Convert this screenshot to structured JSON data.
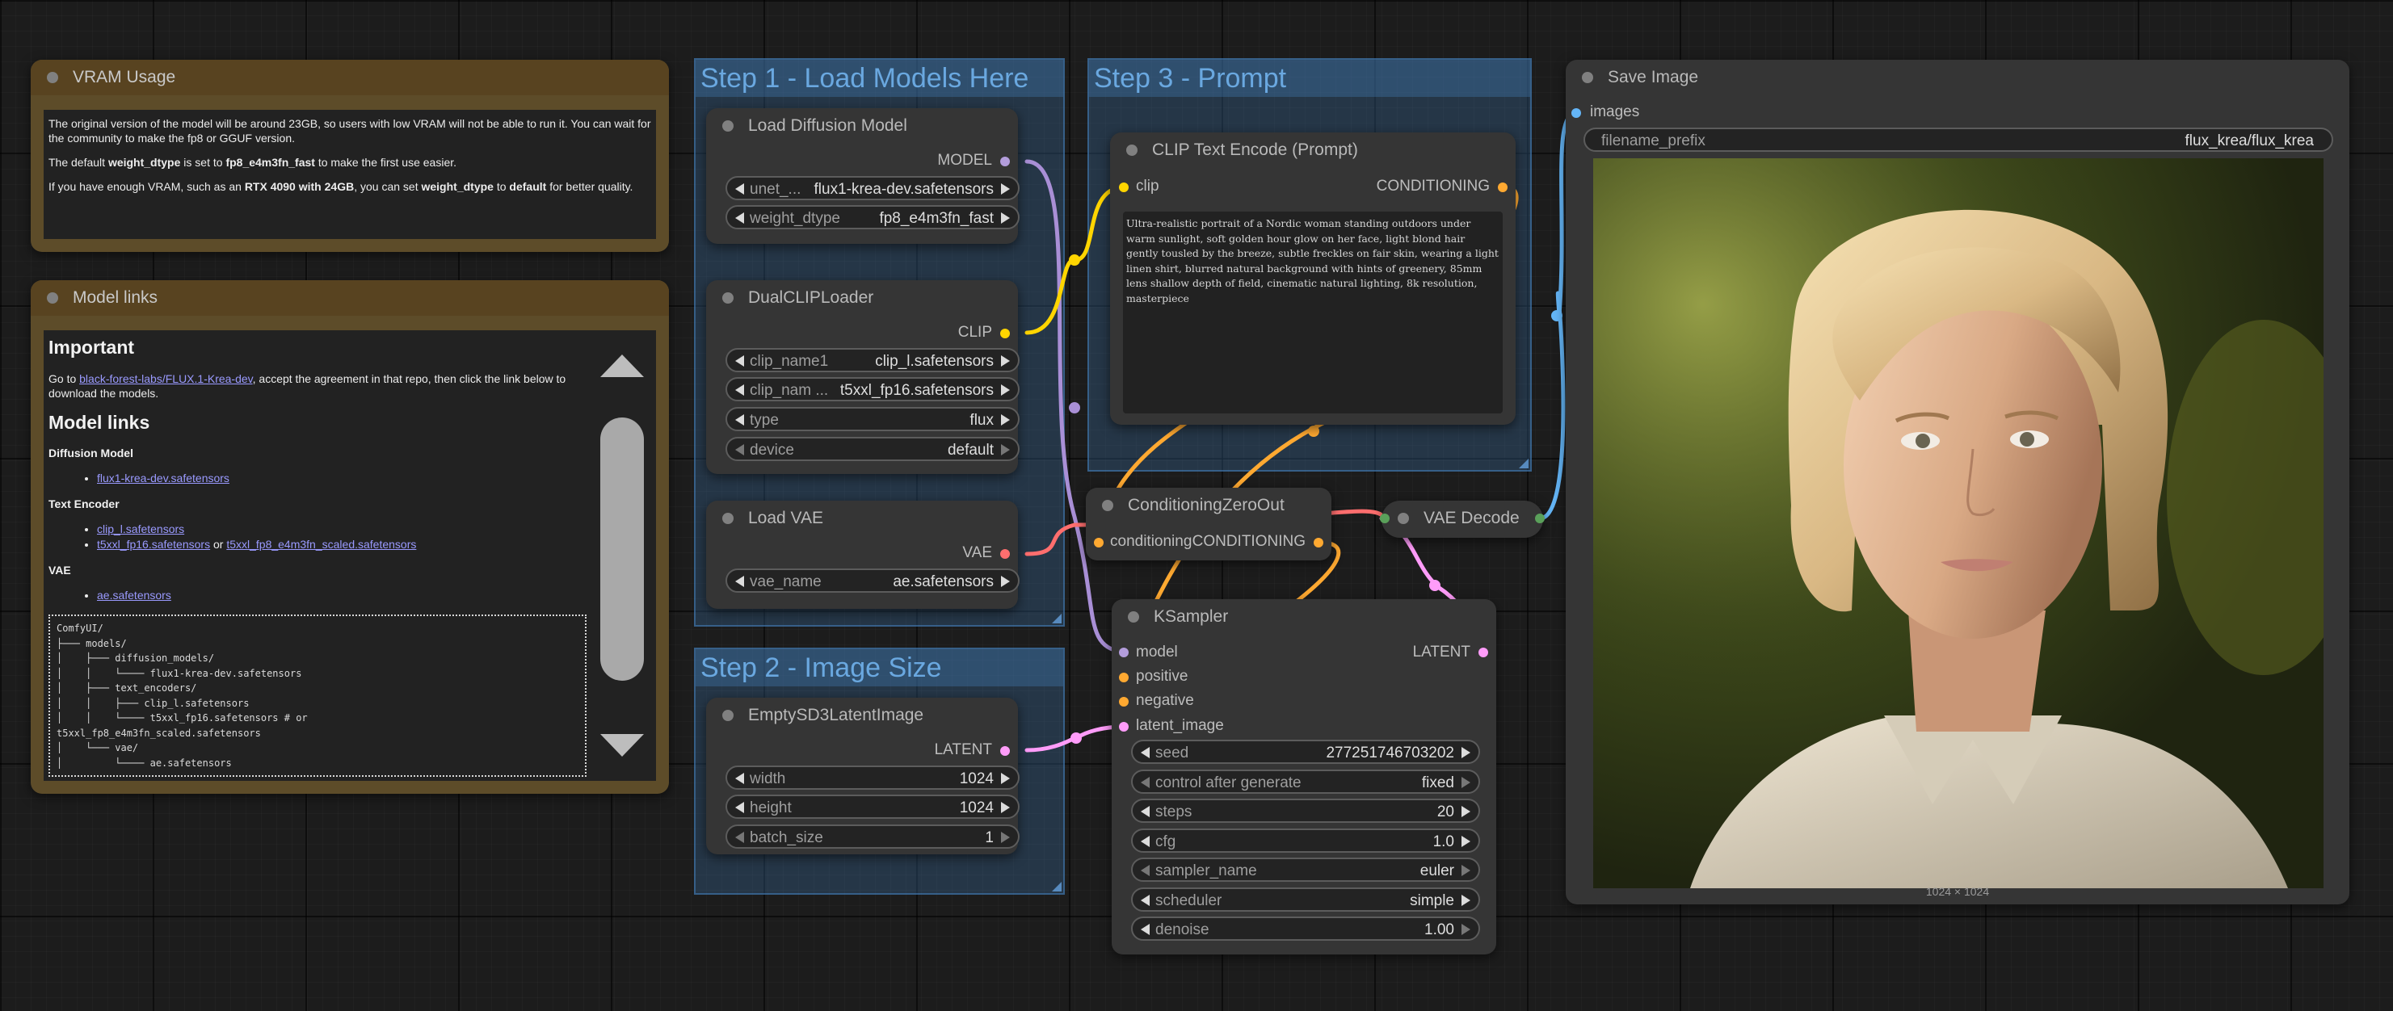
{
  "groups": {
    "step1": "Step 1 - Load Models Here",
    "step2": "Step 2 - Image Size",
    "step3": "Step 3 - Prompt"
  },
  "vram_note": {
    "title": "VRAM Usage",
    "p1": "The original version of the model will be around 23GB, so users with low VRAM will not be able to run it. You can wait for the community to make the fp8 or GGUF version.",
    "p2_pre": "The default ",
    "p2_b1": "weight_dtype",
    "p2_mid": " is set to ",
    "p2_b2": "fp8_e4m3fn_fast",
    "p2_post": " to make the first use easier.",
    "p3_pre": "If you have enough VRAM, such as an ",
    "p3_b1": "RTX 4090 with 24GB",
    "p3_mid": ", you can set ",
    "p3_b2": "weight_dtype",
    "p3_mid2": " to ",
    "p3_b3": "default",
    "p3_post": " for better quality."
  },
  "links_note": {
    "title": "Model links",
    "important_heading": "Important",
    "important_pre": "Go to ",
    "important_link": "black-forest-labs/FLUX.1-Krea-dev",
    "important_post": ", accept the agreement in that repo, then click the link below to download the models.",
    "model_links_heading": "Model links",
    "diffusion_heading": "Diffusion Model",
    "diffusion_link": "flux1-krea-dev.safetensors",
    "text_encoder_heading": "Text Encoder",
    "te_link1": "clip_l.safetensors",
    "te_link2": "t5xxl_fp16.safetensors",
    "te_or": " or ",
    "te_link3": "t5xxl_fp8_e4m3fn_scaled.safetensors",
    "vae_heading": "VAE",
    "vae_link": "ae.safetensors",
    "tree": "ComfyUI/\n├─── models/\n│    ├─── diffusion_models/\n│    │    └──── flux1-krea-dev.safetensors\n│    ├─── text_encoders/\n│    │    ├─── clip_l.safetensors\n│    │    └──── t5xxl_fp16.safetensors # or\nt5xxl_fp8_e4m3fn_scaled.safetensors\n│    └─── vae/\n│         └──── ae.safetensors"
  },
  "load_diffusion": {
    "title": "Load Diffusion Model",
    "output": "MODEL",
    "unet_label": "unet_...",
    "unet_value": "flux1-krea-dev.safetensors",
    "dtype_label": "weight_dtype",
    "dtype_value": "fp8_e4m3fn_fast"
  },
  "dual_clip": {
    "title": "DualCLIPLoader",
    "output": "CLIP",
    "clip1_label": "clip_name1",
    "clip1_value": "clip_l.safetensors",
    "clip2_label": "clip_nam ...",
    "clip2_value": "t5xxl_fp16.safetensors",
    "type_label": "type",
    "type_value": "flux",
    "device_label": "device",
    "device_value": "default"
  },
  "load_vae": {
    "title": "Load VAE",
    "output": "VAE",
    "vae_label": "vae_name",
    "vae_value": "ae.safetensors"
  },
  "empty_latent": {
    "title": "EmptySD3LatentImage",
    "output": "LATENT",
    "width_label": "width",
    "width_value": "1024",
    "height_label": "height",
    "height_value": "1024",
    "batch_label": "batch_size",
    "batch_value": "1"
  },
  "clip_encode": {
    "title": "CLIP Text Encode (Prompt)",
    "input": "clip",
    "output": "CONDITIONING",
    "prompt": "Ultra-realistic portrait of a Nordic woman standing outdoors under warm sunlight, soft golden hour glow on her face, light blond hair gently tousled by the breeze, subtle freckles on fair skin, wearing a light linen shirt, blurred natural background with hints of greenery, 85mm lens shallow depth of field, cinematic natural lighting, 8k resolution, masterpiece"
  },
  "cond_zero": {
    "title": "ConditioningZeroOut",
    "input": "conditioning",
    "output": "CONDITIONING"
  },
  "vae_decode": {
    "title": "VAE Decode"
  },
  "ksampler": {
    "title": "KSampler",
    "in_model": "model",
    "in_positive": "positive",
    "in_negative": "negative",
    "in_latent": "latent_image",
    "output": "LATENT",
    "seed_label": "seed",
    "seed_value": "277251746703202",
    "cag_label": "control after generate",
    "cag_value": "fixed",
    "steps_label": "steps",
    "steps_value": "20",
    "cfg_label": "cfg",
    "cfg_value": "1.0",
    "sampler_label": "sampler_name",
    "sampler_value": "euler",
    "scheduler_label": "scheduler",
    "scheduler_value": "simple",
    "denoise_label": "denoise",
    "denoise_value": "1.00"
  },
  "save_image": {
    "title": "Save Image",
    "input": "images",
    "prefix_label": "filename_prefix",
    "prefix_value": "flux_krea/flux_krea",
    "image_size": "1024 × 1024"
  },
  "colors": {
    "model": "#b39ddb",
    "clip": "#ffd500",
    "vae": "#ff6e6e",
    "conditioning": "#ffa931",
    "latent": "#ff9cf9",
    "image": "#64b5f6"
  }
}
